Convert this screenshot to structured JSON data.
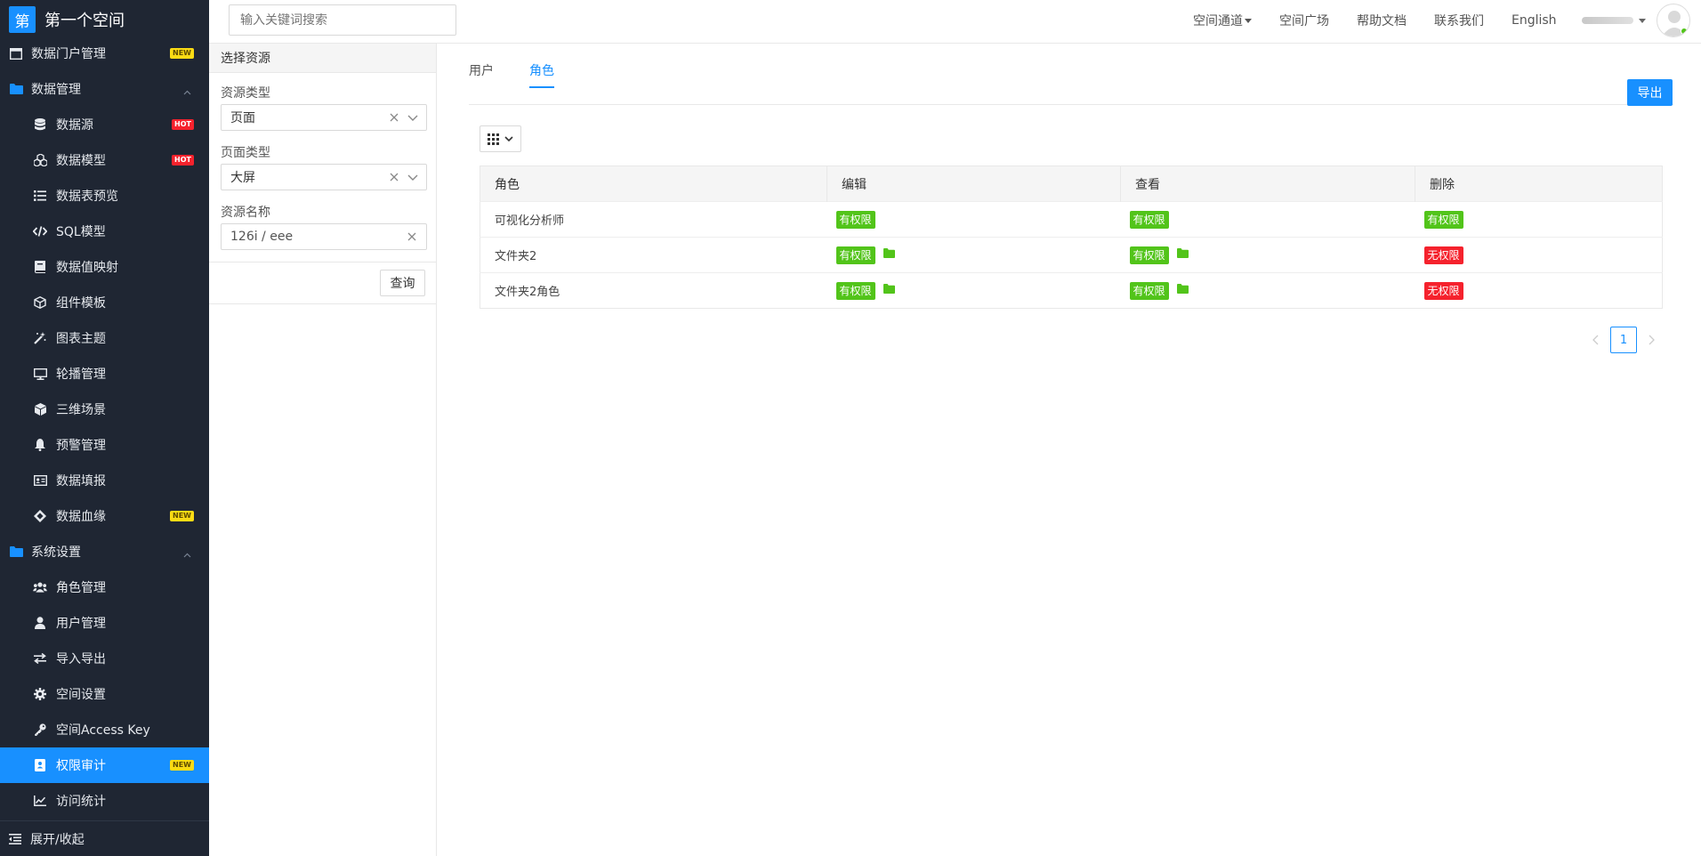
{
  "brand": {
    "logo_text": "第",
    "space_name": "第一个空间"
  },
  "search": {
    "placeholder": "输入关键词搜索"
  },
  "header": {
    "nav": [
      "空间通道",
      "空间广场",
      "帮助文档",
      "联系我们",
      "English"
    ]
  },
  "sidebar": {
    "items": [
      {
        "label": "数据门户管理",
        "level": "top",
        "icon": "portal-icon",
        "badge": "NEW"
      },
      {
        "label": "数据管理",
        "level": "top",
        "icon": "folder-icon",
        "caret": "up"
      },
      {
        "label": "数据源",
        "level": "sub",
        "icon": "database-icon",
        "badge": "HOT"
      },
      {
        "label": "数据模型",
        "level": "sub",
        "icon": "cubes-icon",
        "badge": "HOT"
      },
      {
        "label": "数据表预览",
        "level": "sub",
        "icon": "list-icon"
      },
      {
        "label": "SQL模型",
        "level": "sub",
        "icon": "code-icon"
      },
      {
        "label": "数据值映射",
        "level": "sub",
        "icon": "book-icon"
      },
      {
        "label": "组件模板",
        "level": "sub",
        "icon": "cube-outline-icon"
      },
      {
        "label": "图表主题",
        "level": "sub",
        "icon": "magic-wand-icon"
      },
      {
        "label": "轮播管理",
        "level": "sub",
        "icon": "monitor-icon"
      },
      {
        "label": "三维场景",
        "level": "sub",
        "icon": "cube-icon"
      },
      {
        "label": "预警管理",
        "level": "sub",
        "icon": "bell-icon"
      },
      {
        "label": "数据填报",
        "level": "sub",
        "icon": "id-card-icon"
      },
      {
        "label": "数据血缘",
        "level": "sub",
        "icon": "lineage-icon",
        "badge": "NEW"
      },
      {
        "label": "系统设置",
        "level": "top",
        "icon": "folder-icon",
        "caret": "up"
      },
      {
        "label": "角色管理",
        "level": "sub",
        "icon": "users-icon"
      },
      {
        "label": "用户管理",
        "level": "sub",
        "icon": "user-icon"
      },
      {
        "label": "导入导出",
        "level": "sub",
        "icon": "exchange-icon"
      },
      {
        "label": "空间设置",
        "level": "sub",
        "icon": "gear-icon"
      },
      {
        "label": "空间Access Key",
        "level": "sub",
        "icon": "key-icon"
      },
      {
        "label": "权限审计",
        "level": "sub",
        "icon": "audit-icon",
        "badge": "NEW",
        "active": true
      },
      {
        "label": "访问统计",
        "level": "sub",
        "icon": "chart-line-icon"
      }
    ],
    "collapse_label": "展开/收起"
  },
  "filter": {
    "title": "选择资源",
    "resource_type_label": "资源类型",
    "resource_type_value": "页面",
    "page_type_label": "页面类型",
    "page_type_value": "大屏",
    "resource_name_label": "资源名称",
    "resource_name_value": "126i / eee",
    "query_label": "查询"
  },
  "main": {
    "tabs": [
      {
        "label": "用户",
        "active": false
      },
      {
        "label": "角色",
        "active": true
      }
    ],
    "export_label": "导出",
    "table": {
      "columns": [
        "角色",
        "编辑",
        "查看",
        "删除"
      ],
      "rows": [
        {
          "name": "可视化分析师",
          "edit": "有权限",
          "view": "有权限",
          "delete": "有权限",
          "edit_folder": false,
          "view_folder": false
        },
        {
          "name": "文件夹2",
          "edit": "有权限",
          "view": "有权限",
          "delete": "无权限",
          "edit_folder": true,
          "view_folder": true
        },
        {
          "name": "文件夹2角色",
          "edit": "有权限",
          "view": "有权限",
          "delete": "无权限",
          "edit_folder": true,
          "view_folder": true
        }
      ]
    },
    "pagination": {
      "current": "1"
    }
  },
  "colors": {
    "primary": "#1890ff",
    "sidebar_bg": "#1f2633",
    "granted": "#52c41a",
    "denied": "#f5222d",
    "new_badge": "#fadb14"
  }
}
